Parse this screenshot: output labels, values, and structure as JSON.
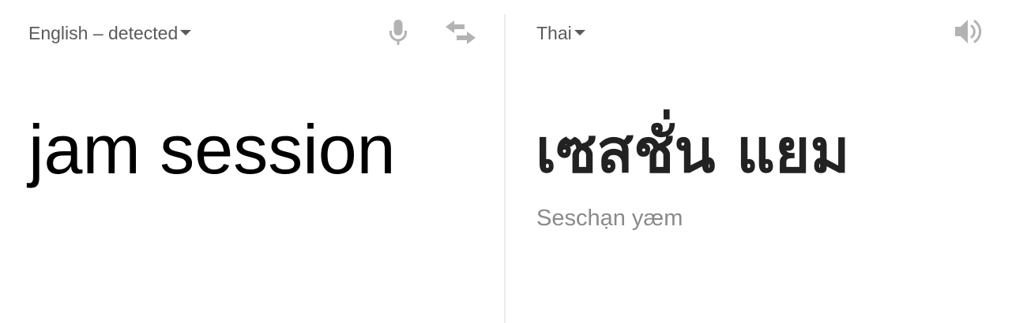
{
  "source": {
    "language_label": "English – detected",
    "text": "jam session",
    "icons": {
      "microphone": "microphone-icon",
      "swap": "swap-languages-icon"
    }
  },
  "target": {
    "language_label": "Thai",
    "text": "เซสชั่น แยม",
    "transliteration": "Seschạn yæm",
    "icons": {
      "listen": "speaker-icon"
    }
  },
  "colors": {
    "label": "#5a5a5a",
    "icon": "#b3b3b3",
    "source_text": "#000000",
    "target_text": "#222222",
    "transliteration": "#8a8a8a",
    "divider": "#ececec"
  }
}
